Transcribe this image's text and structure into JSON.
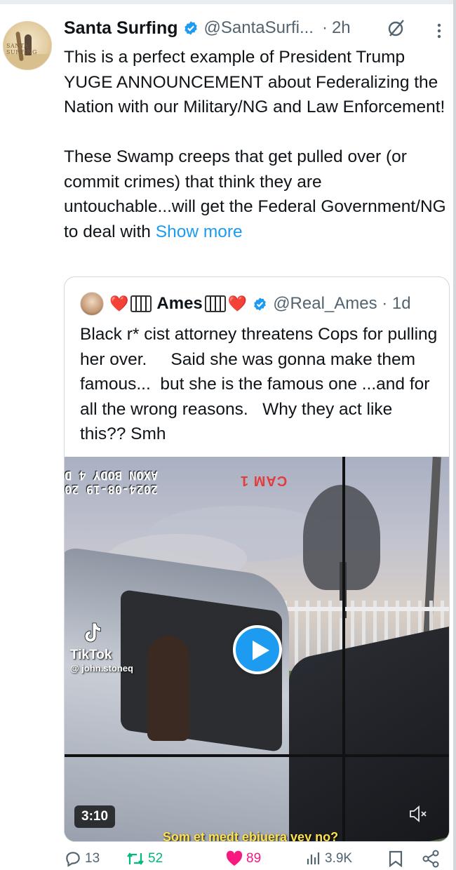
{
  "tweet": {
    "display_name": "Santa Surfing",
    "handle": "@SantaSurfi...",
    "separator": "·",
    "time": "2h",
    "avatar_text": "SANTA SURFING",
    "text": "This is a perfect example of President Trump YUGE ANNOUNCEMENT about Federalizing the Nation with our Military/NG and Law Enforcement!\n\nThese Swamp creeps that get pulled over (or commit crimes) that think they are untouchable...will get the Federal Government/NG to deal with ",
    "show_more": "Show more"
  },
  "quote": {
    "emoji_left": "❤️",
    "display_name": "Ames",
    "emoji_right": "❤️",
    "handle": "@Real_Ames · 1d",
    "text": "Black r* cist attorney threatens Cops for pulling her over.     Said she was gonna make them famous...  but she is the famous one ...and for all the wrong reasons.   Why they act like this?? Smh",
    "video": {
      "stamp_line1": "2024-08-19 20",
      "stamp_line2": "AXON BODY 4 D",
      "cam_label": "CAM 1",
      "tiktok_brand": "TikTok",
      "tiktok_user": "@ john.stoneq",
      "duration": "3:10",
      "caption": "Som et medt ebiuera vey no?"
    }
  },
  "actions": {
    "replies": "13",
    "retweets": "52",
    "likes": "89",
    "views": "3.9K"
  },
  "colors": {
    "accent": "#1d9bf0",
    "retweet": "#00ba7c",
    "like": "#f91880",
    "muted": "#536471"
  }
}
